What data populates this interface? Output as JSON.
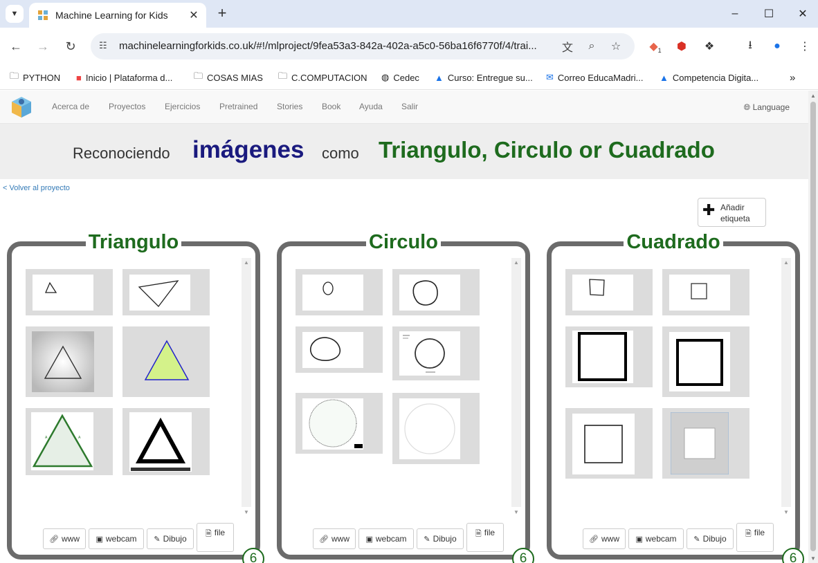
{
  "browser": {
    "tab_title": "Machine Learning for Kids",
    "url": "machinelearningforkids.co.uk/#!/mlproject/9fea53a3-842a-402a-a5c0-56ba16f6770f/4/trai...",
    "bookmarks": [
      "PYTHON",
      "Inicio | Plataforma d...",
      "COSAS MIAS",
      "C.COMPUTACION",
      "Cedec",
      "Curso: Entregue su...",
      "Correo EducaMadri...",
      "Competencia Digita..."
    ],
    "extension_badge": "1"
  },
  "nav": {
    "items": [
      "Acerca de",
      "Proyectos",
      "Ejercicios",
      "Pretrained",
      "Stories",
      "Book",
      "Ayuda",
      "Salir"
    ],
    "language": "Language"
  },
  "heading": {
    "reconociendo": "Reconociendo",
    "type": "imágenes",
    "como": "como",
    "labels": "Triangulo, Circulo or Cuadrado"
  },
  "back_link": "< Volver al proyecto",
  "add_label": {
    "line1": "Añadir",
    "line2": "etiqueta"
  },
  "buttons": {
    "www": "www",
    "webcam": "webcam",
    "draw": "Dibujo",
    "file": "file"
  },
  "buckets": [
    {
      "label": "Triangulo",
      "count": "6"
    },
    {
      "label": "Circulo",
      "count": "6"
    },
    {
      "label": "Cuadrado",
      "count": "6"
    }
  ],
  "colors": {
    "label_green": "#1e6b1e",
    "heading_blue": "#1a1a7e",
    "bin_border": "#6b6b6b"
  }
}
